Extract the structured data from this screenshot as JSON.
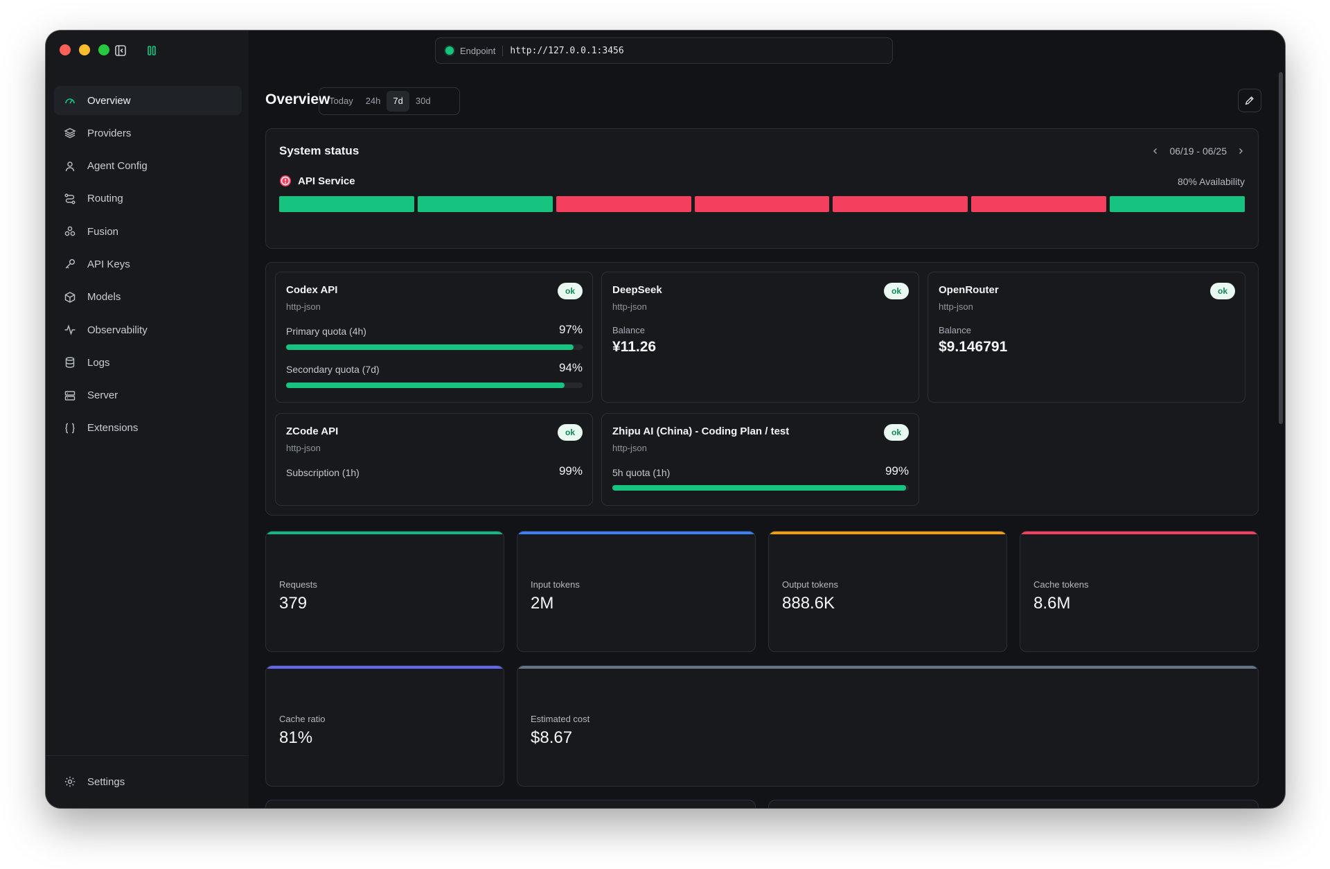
{
  "endpoint": {
    "label": "Endpoint",
    "url": "http://127.0.0.1:3456"
  },
  "sidebar": {
    "items": [
      {
        "label": "Overview",
        "icon": "gauge-icon",
        "active": true
      },
      {
        "label": "Providers",
        "icon": "layers-icon"
      },
      {
        "label": "Agent Config",
        "icon": "user-icon"
      },
      {
        "label": "Routing",
        "icon": "route-icon"
      },
      {
        "label": "Fusion",
        "icon": "fusion-icon"
      },
      {
        "label": "API Keys",
        "icon": "key-icon"
      },
      {
        "label": "Models",
        "icon": "cube-icon"
      },
      {
        "label": "Observability",
        "icon": "activity-icon"
      },
      {
        "label": "Logs",
        "icon": "database-icon"
      },
      {
        "label": "Server",
        "icon": "server-icon"
      },
      {
        "label": "Extensions",
        "icon": "braces-icon"
      }
    ],
    "settings": {
      "label": "Settings",
      "icon": "gear-icon"
    }
  },
  "page": {
    "title": "Overview",
    "ranges": [
      "Today",
      "24h",
      "7d",
      "30d"
    ],
    "selected_range": "7d"
  },
  "status": {
    "title": "System status",
    "date_range": "06/19 - 06/25",
    "service": "API Service",
    "availability": "80% Availability",
    "days": [
      "up",
      "up",
      "down",
      "down",
      "down",
      "down",
      "up"
    ],
    "colors": {
      "up": "#16c47f",
      "down": "#f43f5e"
    }
  },
  "providers": [
    {
      "name": "Codex API",
      "type": "http-json",
      "status": "ok",
      "quotas": [
        {
          "label": "Primary quota (4h)",
          "pct_text": "97%",
          "fill": 0.97
        },
        {
          "label": "Secondary quota (7d)",
          "pct_text": "94%",
          "fill": 0.94
        }
      ]
    },
    {
      "name": "DeepSeek",
      "type": "http-json",
      "status": "ok",
      "balance_label": "Balance",
      "balance": "¥11.26"
    },
    {
      "name": "OpenRouter",
      "type": "http-json",
      "status": "ok",
      "balance_label": "Balance",
      "balance": "$9.146791"
    },
    {
      "name": "ZCode API",
      "type": "http-json",
      "status": "ok",
      "quotas": [
        {
          "label": "Subscription (1h)",
          "pct_text": "99%"
        }
      ]
    },
    {
      "name": "Zhipu AI (China) - Coding Plan / test",
      "type": "http-json",
      "status": "ok",
      "quotas": [
        {
          "label": "5h quota (1h)",
          "pct_text": "99%",
          "fill": 0.99
        }
      ]
    }
  ],
  "metrics": [
    {
      "label": "Requests",
      "value": "379",
      "color": "#10b981"
    },
    {
      "label": "Input tokens",
      "value": "2M",
      "color": "#3b82f6"
    },
    {
      "label": "Output tokens",
      "value": "888.6K",
      "color": "#f59e0b"
    },
    {
      "label": "Cache tokens",
      "value": "8.6M",
      "color": "#f43f5e"
    },
    {
      "label": "Cache ratio",
      "value": "81%",
      "color": "#6366f1"
    },
    {
      "label": "Estimated cost",
      "value": "$8.67",
      "color": "#64748b"
    }
  ]
}
